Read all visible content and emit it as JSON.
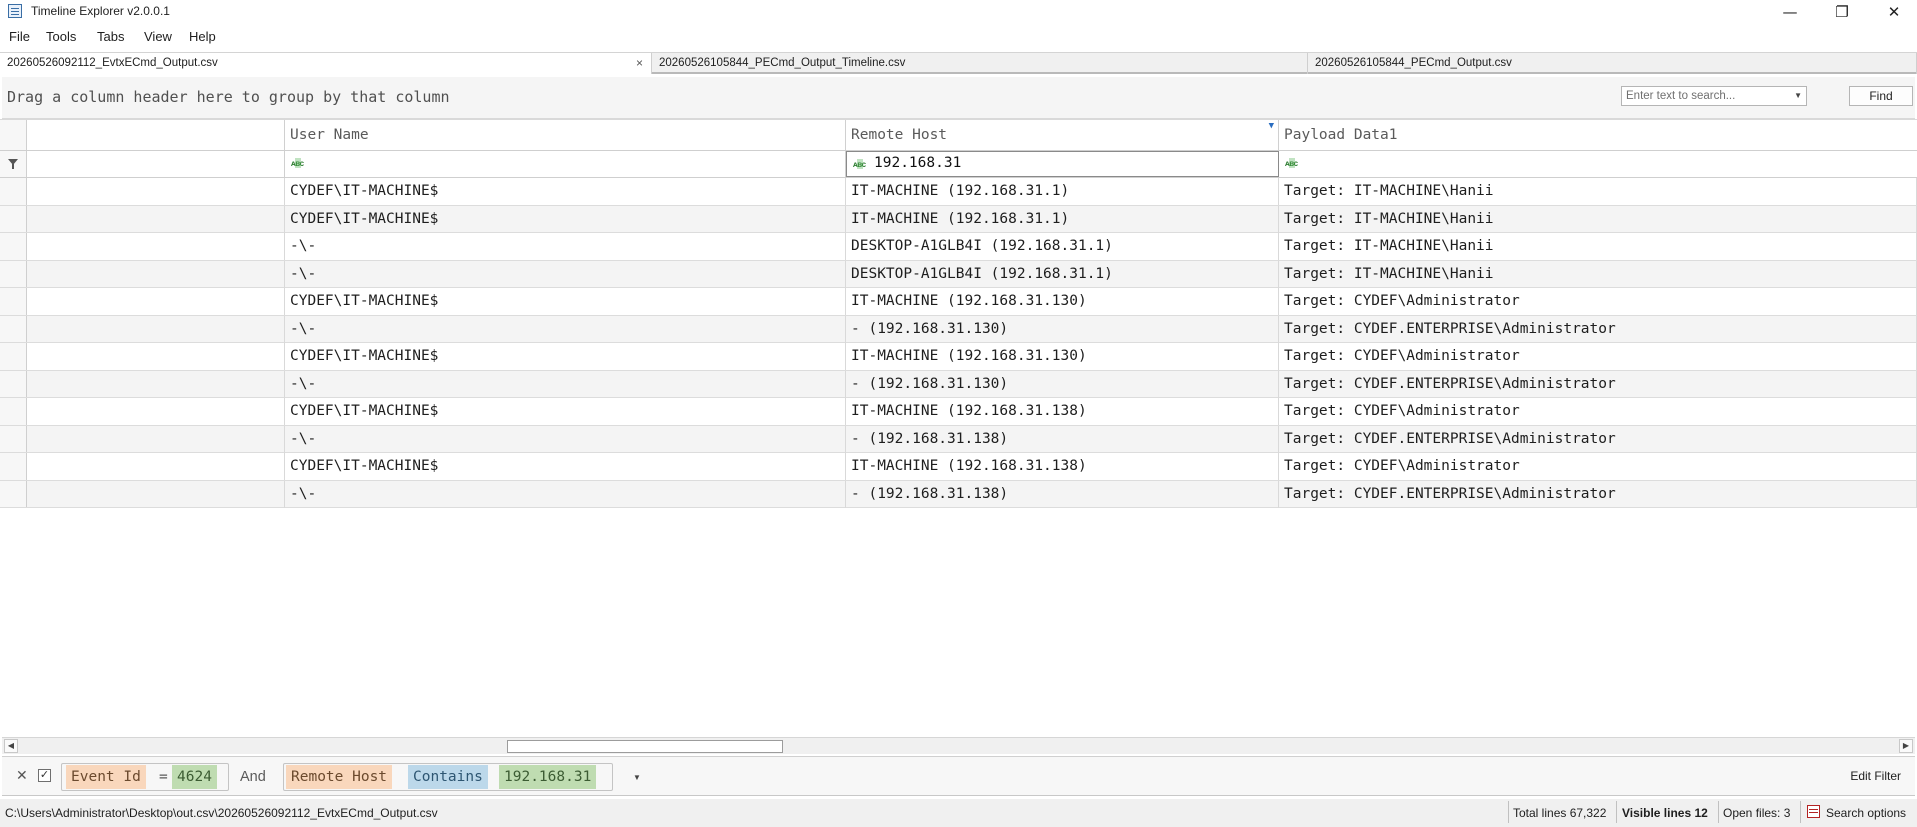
{
  "window": {
    "title": "Timeline Explorer v2.0.0.1",
    "minimize": "—",
    "restore": "❐",
    "close": "✕"
  },
  "menu": [
    "File",
    "Tools",
    "Tabs",
    "View",
    "Help"
  ],
  "tabs": [
    {
      "label": "20260526092112_EvtxECmd_Output.csv",
      "active": true,
      "close": "×"
    },
    {
      "label": "20260526105844_PECmd_Output_Timeline.csv"
    },
    {
      "label": "20260526105844_PECmd_Output.csv"
    }
  ],
  "group_bar": {
    "hint": "Drag a column header here to group by that column",
    "search_placeholder": "Enter text to search...",
    "find_label": "Find"
  },
  "grid": {
    "columns": [
      "",
      "User Name",
      "Remote Host",
      "Payload Data1"
    ],
    "filter": {
      "user_name": "",
      "remote_host": "192.168.31",
      "payload": ""
    },
    "rows": [
      {
        "user": "CYDEF\\IT-MACHINE$",
        "host": "IT-MACHINE (192.168.31.1)",
        "payload": "Target: IT-MACHINE\\Hanii"
      },
      {
        "user": "CYDEF\\IT-MACHINE$",
        "host": "IT-MACHINE (192.168.31.1)",
        "payload": "Target: IT-MACHINE\\Hanii"
      },
      {
        "user": "-\\-",
        "host": "DESKTOP-A1GLB4I (192.168.31.1)",
        "payload": "Target: IT-MACHINE\\Hanii"
      },
      {
        "user": "-\\-",
        "host": "DESKTOP-A1GLB4I (192.168.31.1)",
        "payload": "Target: IT-MACHINE\\Hanii"
      },
      {
        "user": "CYDEF\\IT-MACHINE$",
        "host": "IT-MACHINE (192.168.31.130)",
        "payload": "Target: CYDEF\\Administrator"
      },
      {
        "user": "-\\-",
        "host": "- (192.168.31.130)",
        "payload": "Target: CYDEF.ENTERPRISE\\Administrator"
      },
      {
        "user": "CYDEF\\IT-MACHINE$",
        "host": "IT-MACHINE (192.168.31.130)",
        "payload": "Target: CYDEF\\Administrator"
      },
      {
        "user": "-\\-",
        "host": "- (192.168.31.130)",
        "payload": "Target: CYDEF.ENTERPRISE\\Administrator"
      },
      {
        "user": "CYDEF\\IT-MACHINE$",
        "host": "IT-MACHINE (192.168.31.138)",
        "payload": "Target: CYDEF\\Administrator"
      },
      {
        "user": "-\\-",
        "host": "- (192.168.31.138)",
        "payload": "Target: CYDEF.ENTERPRISE\\Administrator"
      },
      {
        "user": "CYDEF\\IT-MACHINE$",
        "host": "IT-MACHINE (192.168.31.138)",
        "payload": "Target: CYDEF\\Administrator"
      },
      {
        "user": "-\\-",
        "host": "- (192.168.31.138)",
        "payload": "Target: CYDEF.ENTERPRISE\\Administrator"
      }
    ]
  },
  "filter_bar": {
    "field1": "Event Id",
    "op1": "=",
    "value1": "4624",
    "conjunction": "And",
    "field2": "Remote Host",
    "op2": "Contains",
    "value2": "192.168.31",
    "edit_label": "Edit Filter"
  },
  "status": {
    "path": "C:\\Users\\Administrator\\Desktop\\out.csv\\20260526092112_EvtxECmd_Output.csv",
    "total_lines": "Total lines 67,322",
    "visible_lines": "Visible lines 12",
    "open_files": "Open files: 3",
    "search_options": "Search options"
  },
  "icons": [
    "app-icon",
    "filter-funnel-icon",
    "abc-text-filter-icon",
    "sort-marker-icon",
    "search-options-icon",
    "dropdown-arrow-icon"
  ],
  "colors": {
    "field_token": "#f9d7bc",
    "value_token": "#bfdcb1",
    "condition_token": "#bcd8ea",
    "alt_row": "#f4f4f4"
  }
}
